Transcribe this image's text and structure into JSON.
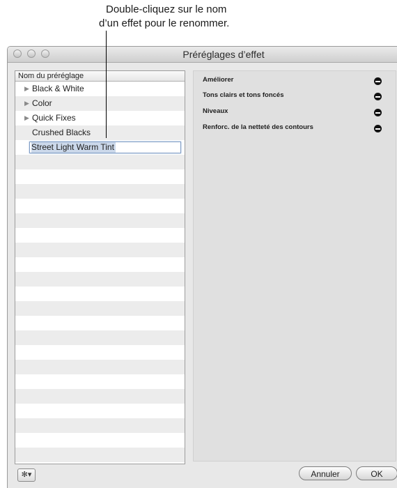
{
  "callout": {
    "line1": "Double-cliquez sur le nom",
    "line2": "d’un effet pour le renommer."
  },
  "window": {
    "title": "Préréglages d’effet"
  },
  "presets": {
    "column_header": "Nom du préréglage",
    "items": [
      {
        "label": "Black & White",
        "disclosure": "triangle-right-icon"
      },
      {
        "label": "Color",
        "disclosure": "triangle-right-icon"
      },
      {
        "label": "Quick Fixes",
        "disclosure": "triangle-right-icon"
      },
      {
        "label": "Crushed Blacks"
      }
    ],
    "editing_value": "Street Light Warm Tint"
  },
  "effects": [
    {
      "label": "Améliorer",
      "remove_icon": "minus-circle-icon"
    },
    {
      "label": "Tons clairs et tons foncés",
      "remove_icon": "minus-circle-icon"
    },
    {
      "label": "Niveaux",
      "remove_icon": "minus-circle-icon"
    },
    {
      "label": "Renforc. de la netteté des contours",
      "remove_icon": "minus-circle-icon"
    }
  ],
  "footer": {
    "gear_icon": "gear-icon",
    "cancel_label": "Annuler",
    "ok_label": "OK"
  }
}
